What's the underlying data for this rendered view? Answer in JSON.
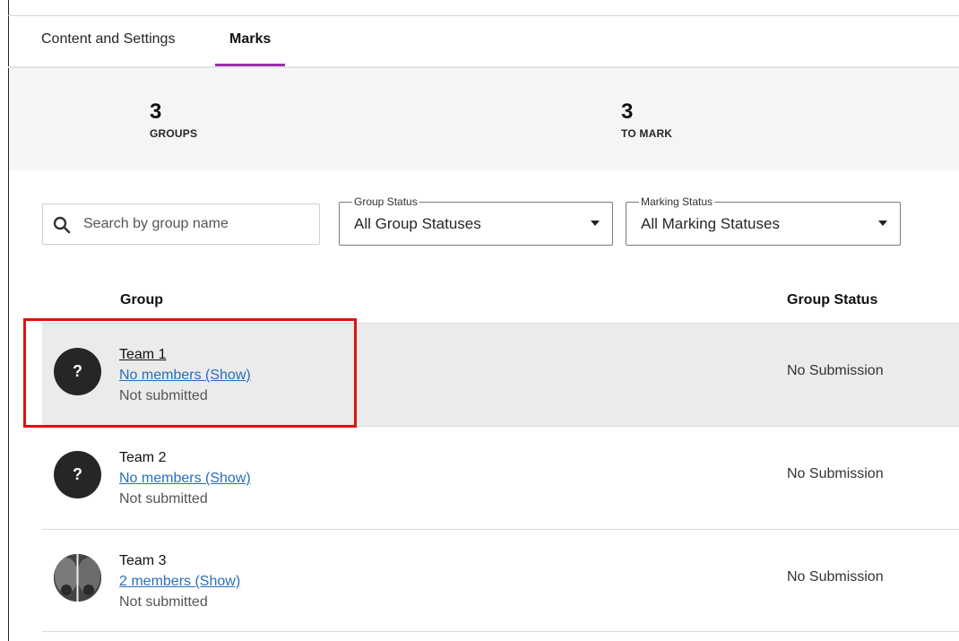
{
  "tabs": [
    {
      "label": "Content and Settings",
      "active": false
    },
    {
      "label": "Marks",
      "active": true
    }
  ],
  "summary": {
    "groups_count": "3",
    "groups_label": "GROUPS",
    "to_mark_count": "3",
    "to_mark_label": "TO MARK"
  },
  "search": {
    "placeholder": "Search by group name",
    "value": ""
  },
  "filters": {
    "group_status": {
      "legend": "Group Status",
      "selected": "All Group Statuses"
    },
    "marking_status": {
      "legend": "Marking Status",
      "selected": "All Marking Statuses"
    }
  },
  "table": {
    "columns": [
      "Group",
      "Group Status"
    ],
    "rows": [
      {
        "name": "Team 1",
        "members": "No members (Show)",
        "submission": "Not submitted",
        "status": "No Submission",
        "avatar_text": "?",
        "selected": true
      },
      {
        "name": "Team 2",
        "members": "No members (Show)",
        "submission": "Not submitted",
        "status": "No Submission",
        "avatar_text": "?",
        "selected": false
      },
      {
        "name": "Team 3",
        "members": "2 members (Show)",
        "submission": "Not submitted",
        "status": "No Submission",
        "avatar_text": "",
        "selected": false
      }
    ]
  },
  "colors": {
    "accent": "#9b2fae",
    "link": "#2a6eb8",
    "highlight": "#e01010"
  }
}
